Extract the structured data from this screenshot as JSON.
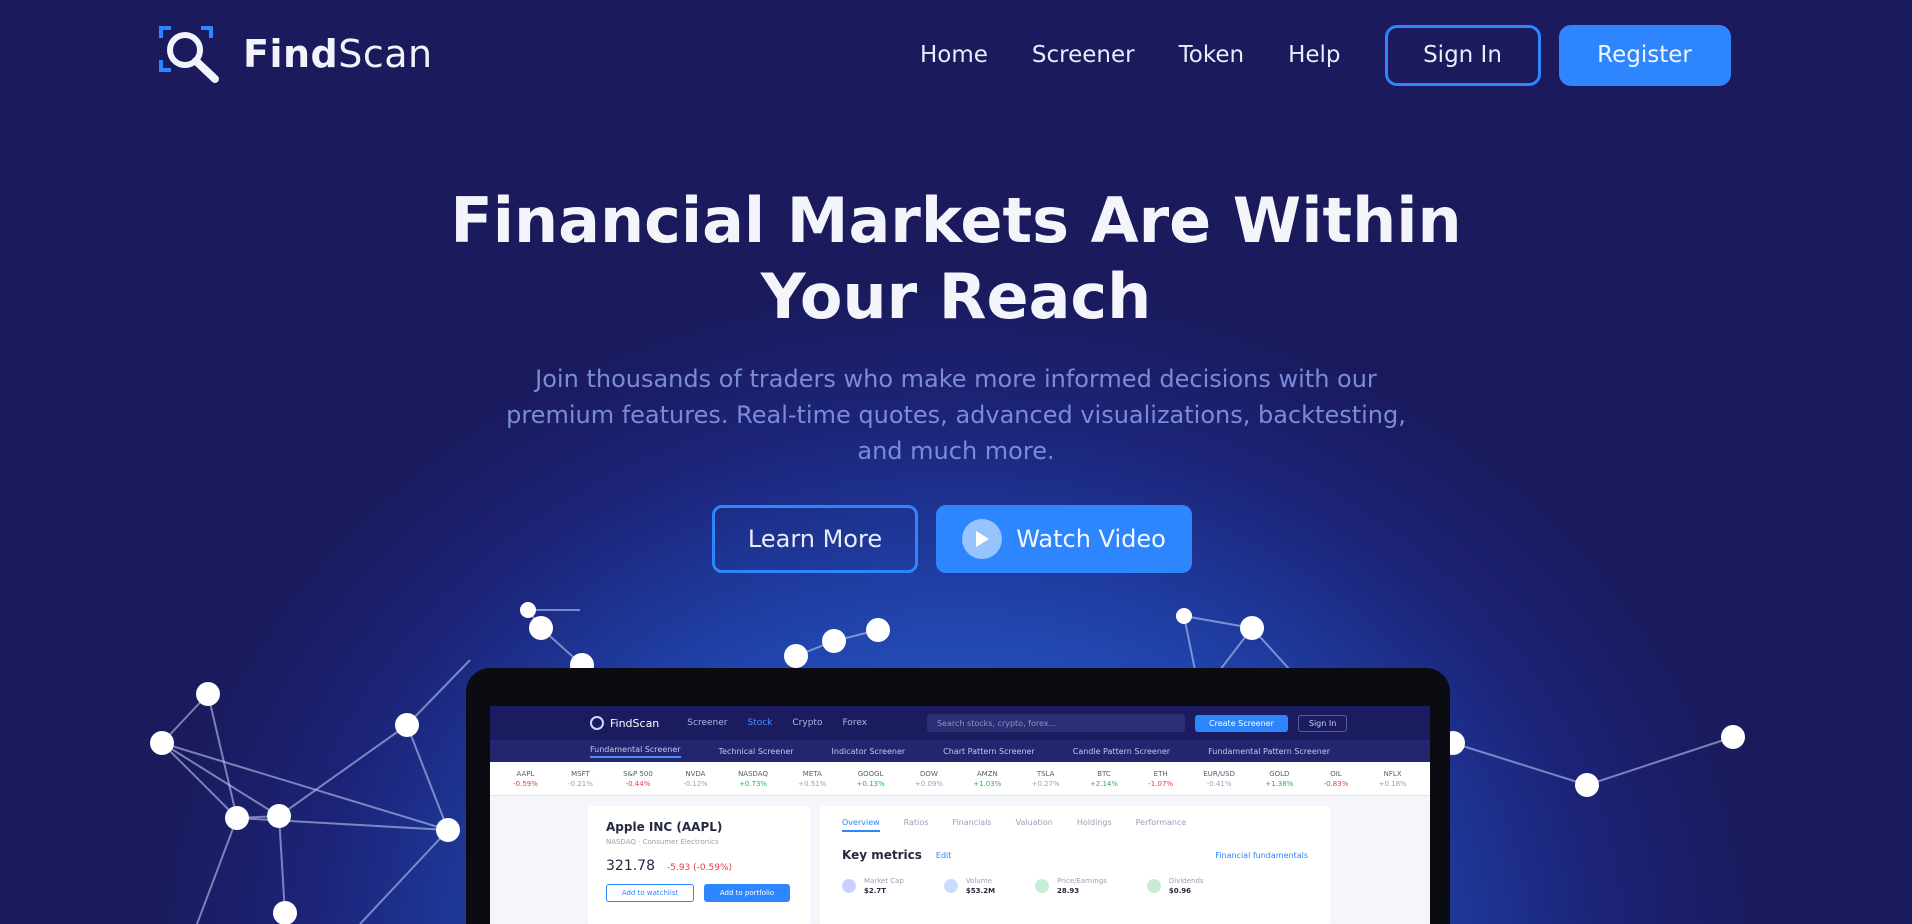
{
  "brand": {
    "name_bold": "Find",
    "name_rest": "Scan"
  },
  "nav": {
    "links": [
      "Home",
      "Screener",
      "Token",
      "Help"
    ],
    "sign_in": "Sign In",
    "register": "Register"
  },
  "hero": {
    "title_line1": "Financial Markets Are Within",
    "title_line2": "Your Reach",
    "subtitle_line1": "Join thousands of traders who make more informed decisions with our",
    "subtitle_line2": "premium features. Real-time quotes, advanced visualizations, backtesting,",
    "subtitle_line3": "and much more.",
    "learn_more": "Learn More",
    "watch_video": "Watch Video"
  },
  "colors": {
    "background": "#1a1a5c",
    "accent": "#2e86ff",
    "hero_glow": "#2f6fe0"
  },
  "app_preview": {
    "logo": "FindScan",
    "menu": [
      "Screener",
      "Stock",
      "Crypto",
      "Forex"
    ],
    "search_placeholder": "Search stocks, crypto, forex...",
    "create_button": "Create Screener",
    "sign_button": "Sign In",
    "tabs": [
      "Fundamental Screener",
      "Technical Screener",
      "Indicator Screener",
      "Chart Pattern Screener",
      "Candle Pattern Screener",
      "Fundamental Pattern Screener"
    ],
    "ticker": [
      {
        "sym": "AAPL",
        "chg": "-0.59%",
        "dir": "dn"
      },
      {
        "sym": "MSFT",
        "chg": "-0.21%",
        "dir": "mu"
      },
      {
        "sym": "S&P 500",
        "chg": "-0.44%",
        "dir": "dn"
      },
      {
        "sym": "NVDA",
        "chg": "-0.12%",
        "dir": "mu"
      },
      {
        "sym": "NASDAQ",
        "chg": "+0.73%",
        "dir": "up"
      },
      {
        "sym": "META",
        "chg": "+0.51%",
        "dir": "mu"
      },
      {
        "sym": "GOOGL",
        "chg": "+0.13%",
        "dir": "up"
      },
      {
        "sym": "DOW",
        "chg": "+0.09%",
        "dir": "mu"
      },
      {
        "sym": "AMZN",
        "chg": "+1.03%",
        "dir": "up"
      },
      {
        "sym": "TSLA",
        "chg": "+0.27%",
        "dir": "mu"
      },
      {
        "sym": "BTC",
        "chg": "+2.14%",
        "dir": "up"
      },
      {
        "sym": "ETH",
        "chg": "-1.07%",
        "dir": "dn"
      },
      {
        "sym": "EUR/USD",
        "chg": "-0.41%",
        "dir": "mu"
      },
      {
        "sym": "GOLD",
        "chg": "+1.38%",
        "dir": "up"
      },
      {
        "sym": "OIL",
        "chg": "-0.83%",
        "dir": "dn"
      },
      {
        "sym": "NFLX",
        "chg": "+0.18%",
        "dir": "mu"
      }
    ],
    "stock_title": "Apple INC (AAPL)",
    "stock_sub": "NASDAQ · Consumer Electronics",
    "stock_price": "321.78",
    "stock_change": "-5.93 (-0.59%)",
    "watchlist_btn": "Add to watchlist",
    "compare_btn": "Add to portfolio",
    "detail_tabs": [
      "Overview",
      "Ratios",
      "Financials",
      "Valuation",
      "Holdings",
      "Performance"
    ],
    "key_metrics": "Key metrics",
    "edit": "Edit",
    "fundamentals": "Financial fundamentals",
    "metrics": [
      {
        "label": "Market Cap",
        "value": "$2.7T",
        "color": "#c9d2ff"
      },
      {
        "label": "Volume",
        "value": "$53.2M",
        "color": "#c9dcff"
      },
      {
        "label": "Price/Earnings",
        "value": "28.93",
        "color": "#c7eed8"
      },
      {
        "label": "Dividends",
        "value": "$0.96",
        "color": "#c8ecd1"
      }
    ]
  }
}
